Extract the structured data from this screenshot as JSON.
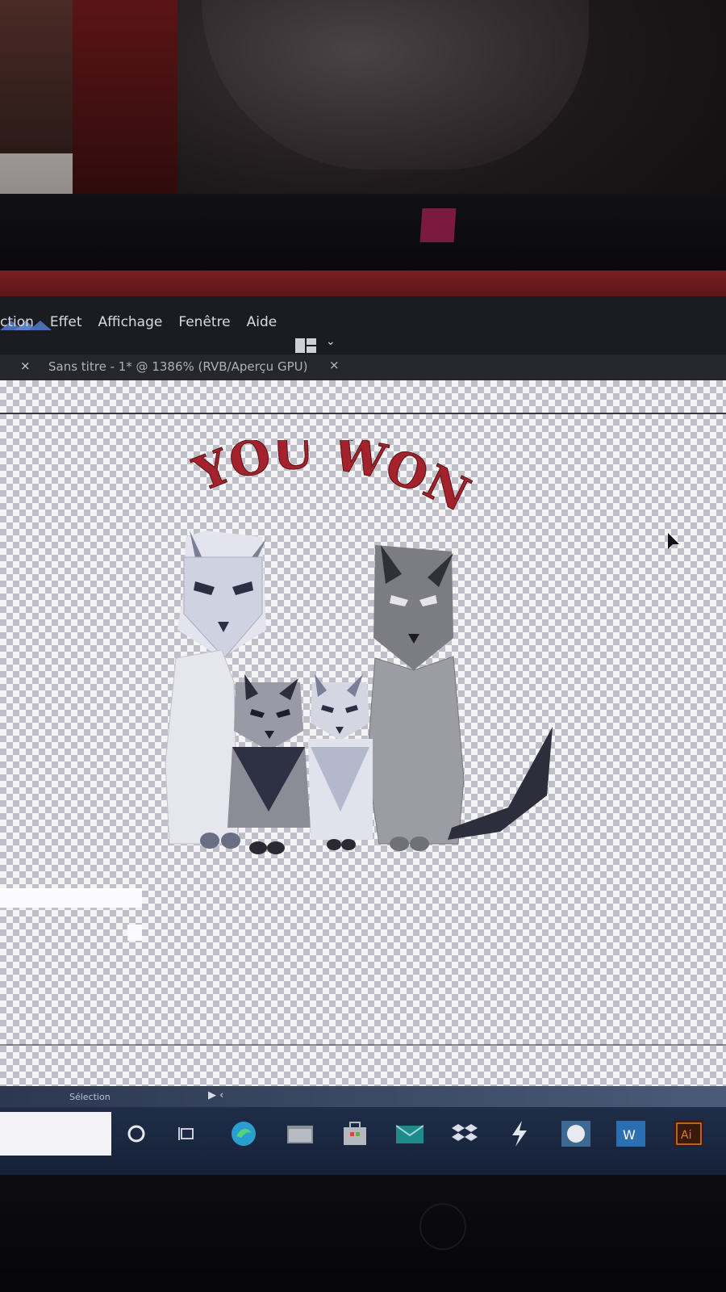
{
  "menu": {
    "items": [
      "ction",
      "Effet",
      "Affichage",
      "Fenêtre",
      "Aide"
    ]
  },
  "document_tab": {
    "title": "Sans titre - 1* @ 1386% (RVB/Aperçu GPU)",
    "close_glyph": "×",
    "prev_close_glyph": "×"
  },
  "artwork": {
    "headline": "YOU WON",
    "headline_color": "#a3222c",
    "subject": "geometric cat family"
  },
  "status_bar": {
    "tool_label": "Sélection"
  },
  "taskbar": {
    "icons": [
      "search-circle-icon",
      "task-view-icon",
      "edge-icon",
      "file-explorer-icon",
      "store-icon",
      "mail-icon",
      "dropbox-icon",
      "lightning-icon",
      "app-circle-icon",
      "word-icon",
      "illustrator-icon"
    ],
    "illustrator_label": "Ai",
    "word_label": "W"
  },
  "colors": {
    "brand_bar": "#7a1e22",
    "menubar": "#1b1c22",
    "taskbar": "#1f2d48"
  }
}
